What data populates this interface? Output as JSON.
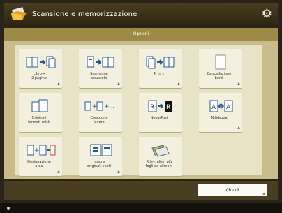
{
  "header": {
    "title": "Scansione e memorizzazione",
    "app_icon": "folder-scan-icon",
    "settings_icon": "gear-icon"
  },
  "subheader": {
    "title": "Opzioni"
  },
  "options": [
    {
      "label": "Libro→\n2 pagine",
      "icon": "book-to-two-pages-icon",
      "has_menu": true
    },
    {
      "label": "Scansione\nopuscolo",
      "icon": "booklet-scan-icon",
      "has_menu": true
    },
    {
      "label": "N in 1",
      "icon": "n-in-1-icon",
      "has_menu": true
    },
    {
      "label": "Cancellazione\nbordi",
      "icon": "erase-frame-icon",
      "has_menu": true
    },
    {
      "label": "Originali\nformati misti",
      "icon": "mixed-size-originals-icon",
      "has_menu": false
    },
    {
      "label": "Creazione\nlavoro",
      "icon": "job-build-icon",
      "has_menu": false
    },
    {
      "label": "Nega/Posi",
      "icon": "negative-positive-icon",
      "has_menu": false
    },
    {
      "label": "Nitidezza",
      "icon": "sharpness-icon",
      "has_menu": true
    },
    {
      "label": "Designazione\narea",
      "icon": "area-designation-icon",
      "has_menu": true
    },
    {
      "label": "Ignora\noriginali vuoti",
      "icon": "skip-blank-originals-icon",
      "has_menu": true
    },
    {
      "label": "Rilev. alim. più\nfogli da alimen.",
      "icon": "multi-feed-detection-icon",
      "has_menu": false
    }
  ],
  "footer": {
    "close_label": "Chiudi"
  },
  "colors": {
    "header": "#3a3019",
    "subheader": "#9c8a46",
    "panel": "#c8bc8c",
    "tile": "#f4f0e0"
  }
}
